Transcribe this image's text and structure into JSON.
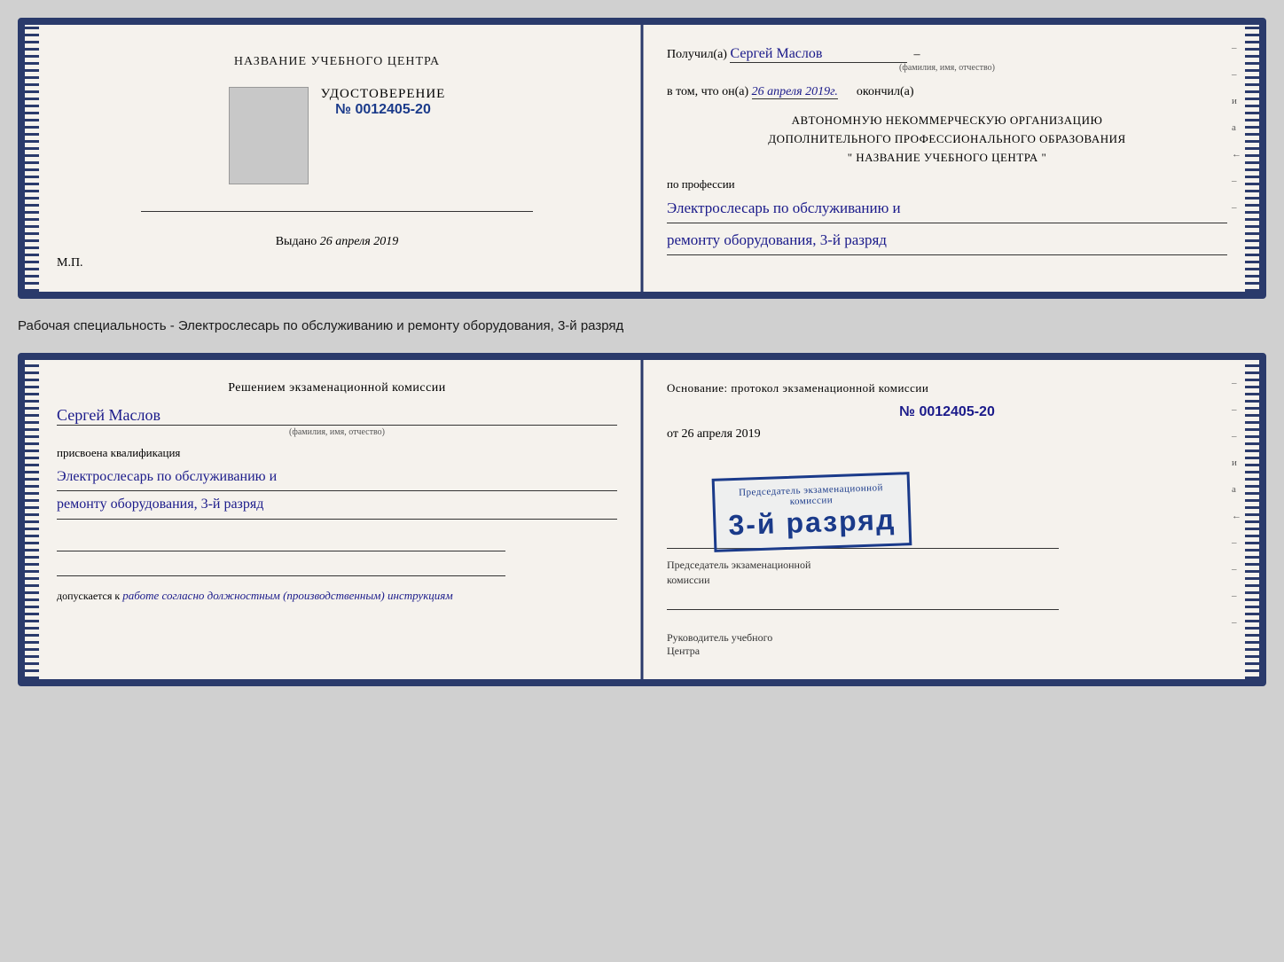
{
  "top_doc": {
    "left": {
      "center_title": "НАЗВАНИЕ УЧЕБНОГО ЦЕНТРА",
      "cert_label": "УДОСТОВЕРЕНИЕ",
      "cert_number_prefix": "№",
      "cert_number": "0012405-20",
      "issued_prefix": "Выдано",
      "issued_date": "26 апреля 2019",
      "mp_label": "М.П."
    },
    "right": {
      "recipient_prefix": "Получил(а)",
      "recipient_name": "Сергей Маслов",
      "fio_subtitle": "(фамилия, имя, отчество)",
      "date_prefix": "в том, что он(а)",
      "date_value": "26 апреля 2019г.",
      "date_suffix": "окончил(а)",
      "org_line1": "АВТОНОМНУЮ НЕКОММЕРЧЕСКУЮ ОРГАНИЗАЦИЮ",
      "org_line2": "ДОПОЛНИТЕЛЬНОГО ПРОФЕССИОНАЛЬНОГО ОБРАЗОВАНИЯ",
      "org_line3": "\" НАЗВАНИЕ УЧЕБНОГО ЦЕНТРА \"",
      "profession_prefix": "по профессии",
      "profession_line1": "Электрослесарь по обслуживанию и",
      "profession_line2": "ремонту оборудования, 3-й разряд"
    }
  },
  "between_label": "Рабочая специальность - Электрослесарь по обслуживанию и ремонту оборудования, 3-й разряд",
  "bottom_doc": {
    "left": {
      "commission_title": "Решением экзаменационной комиссии",
      "person_name": "Сергей Маслов",
      "fio_subtitle": "(фамилия, имя, отчество)",
      "qualification_prefix": "присвоена квалификация",
      "qualification_line1": "Электрослесарь по обслуживанию и",
      "qualification_line2": "ремонту оборудования, 3-й разряд",
      "admission_prefix": "допускается к",
      "admission_text": "работе согласно должностным (производственным) инструкциям"
    },
    "right": {
      "basis_label": "Основание: протокол экзаменационной комиссии",
      "number_prefix": "№",
      "number": "0012405-20",
      "date_prefix": "от",
      "date_value": "26 апреля 2019",
      "stamp_line1": "Председатель экзаменационной",
      "stamp_line2": "комиссии",
      "stamp_grade": "3-й разряд",
      "head_label1": "Руководитель учебного",
      "head_label2": "Центра"
    }
  },
  "right_margin": {
    "chars": [
      "и",
      "а",
      "←",
      "–",
      "–",
      "–",
      "–"
    ]
  }
}
